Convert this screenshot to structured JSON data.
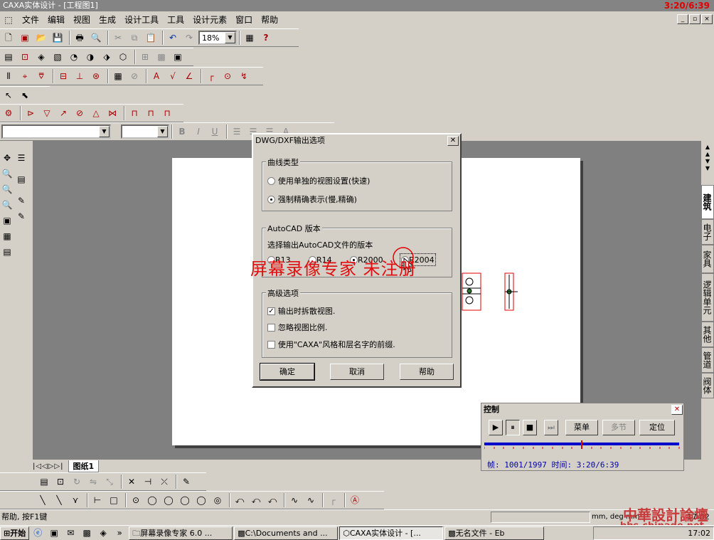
{
  "window": {
    "title": "CAXA实体设计 - [工程图1]",
    "clock": "3:20/6:39"
  },
  "menu": [
    "文件",
    "编辑",
    "视图",
    "生成",
    "设计工具",
    "工具",
    "设计元素",
    "窗口",
    "帮助"
  ],
  "toolbar": {
    "zoom": "18%"
  },
  "sheet_tab": "图纸1",
  "right_tabs": [
    "建筑",
    "电子",
    "家具",
    "逻辑单元",
    "其他",
    "管道",
    "阀体"
  ],
  "dialog": {
    "title": "DWG/DXF输出选项",
    "curve_group": "曲线类型",
    "curve_options": [
      "使用单独的视图设置(快速)",
      "强制精确表示(慢,精确)"
    ],
    "curve_selected": 1,
    "autocad_group": "AutoCAD 版本",
    "autocad_prompt": "选择输出AutoCAD文件的版本",
    "versions": [
      "R13",
      "R14",
      "R2000",
      "R2004"
    ],
    "version_selected": 2,
    "advanced_group": "高级选项",
    "advanced_options": [
      {
        "label": "输出时拆散视图.",
        "checked": true
      },
      {
        "label": "忽略视图比例.",
        "checked": false
      },
      {
        "label": "使用\"CAXA\"风格和层名字的前缀.",
        "checked": false
      }
    ],
    "ok": "确定",
    "cancel": "取消",
    "help": "帮助"
  },
  "watermark": "屏幕录像专家 未注册",
  "control": {
    "title": "控制",
    "menu_btn": "菜单",
    "multi_btn": "多节",
    "locate_btn": "定位",
    "status": "帧: 1001/1997 时间: 3:20/6:39",
    "progress": 0.5
  },
  "statusbar": {
    "text": "帮助, 按F1键",
    "units": "mm, deg   mm",
    "time": "17:02"
  },
  "taskbar": {
    "start": "开始",
    "items": [
      "屏幕录像专家 6.0 ...",
      "C:\\Documents and ...",
      "CAXA实体设计 - [...",
      "无名文件 - Eb"
    ],
    "active": 2,
    "time": "17:02"
  },
  "brand_watermark": {
    "line1": "中華設計論壇",
    "line2": "bbs.chinade.net"
  }
}
